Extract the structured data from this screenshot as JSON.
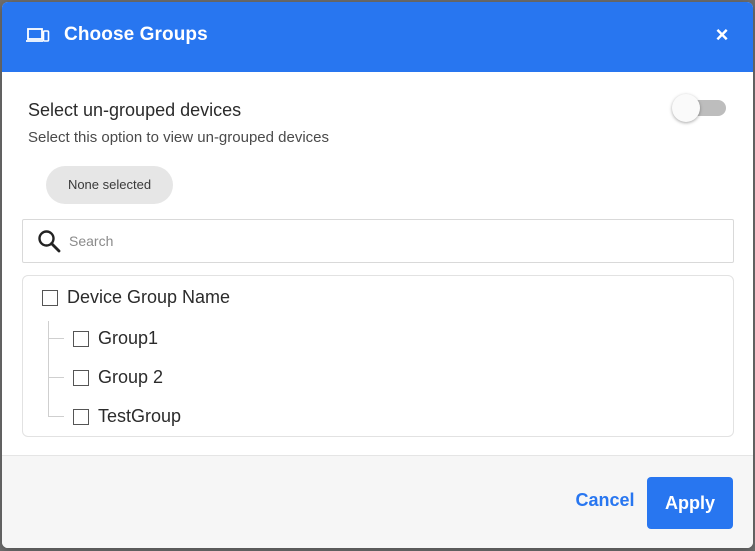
{
  "dialog": {
    "title": "Choose Groups",
    "header_icon": "devices-icon",
    "close_label": "×"
  },
  "ungrouped": {
    "title": "Select un-grouped devices",
    "description": "Select this option to view un-grouped devices",
    "toggle_on": false
  },
  "selection_chip": "None selected",
  "search": {
    "placeholder": "Search",
    "value": ""
  },
  "tree": {
    "root": {
      "label": "Device Group Name",
      "checked": false
    },
    "children": [
      {
        "label": "Group1",
        "checked": false
      },
      {
        "label": "Group 2",
        "checked": false
      },
      {
        "label": "TestGroup",
        "checked": false
      }
    ]
  },
  "footer": {
    "cancel_label": "Cancel",
    "apply_label": "Apply"
  },
  "colors": {
    "primary": "#2876f0",
    "header_text": "#ffffff",
    "toggle_track": "#bdbdbd"
  }
}
